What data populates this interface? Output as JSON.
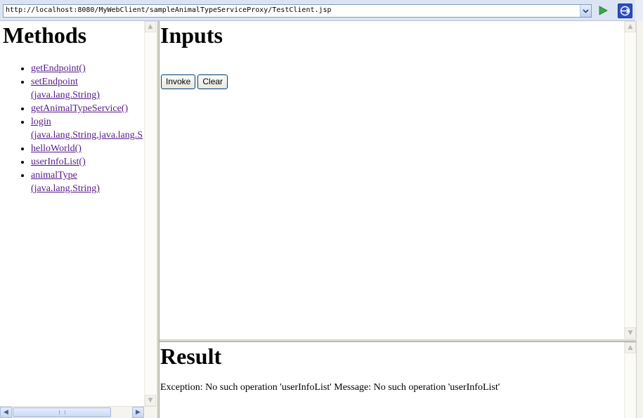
{
  "address_bar": {
    "url": "http://localhost:8080/MyWebClient/sampleAnimalTypeServiceProxy/TestClient.jsp",
    "dropdown_icon": "chevron-down-icon",
    "go_icon": "play-triangle-icon",
    "external_icon": "open-external-icon"
  },
  "methods": {
    "title": "Methods",
    "items": [
      {
        "line1": "getEndpoint()",
        "line2": ""
      },
      {
        "line1": "setEndpoint",
        "line2": "(java.lang.String)"
      },
      {
        "line1": "getAnimalTypeService()",
        "line2": ""
      },
      {
        "line1": "login",
        "line2": "(java.lang.String,java.lang.S"
      },
      {
        "line1": "helloWorld()",
        "line2": ""
      },
      {
        "line1": "userInfoList()",
        "line2": ""
      },
      {
        "line1": "animalType",
        "line2": "(java.lang.String)"
      }
    ]
  },
  "inputs": {
    "title": "Inputs",
    "invoke_label": "Invoke",
    "clear_label": "Clear"
  },
  "result": {
    "title": "Result",
    "message": "Exception: No such operation 'userInfoList' Message: No such operation 'userInfoList'"
  },
  "colors": {
    "link_visited": "#551a8b",
    "toolbar_bg": "#dce4f4",
    "splitter": "#d8d6cb"
  }
}
